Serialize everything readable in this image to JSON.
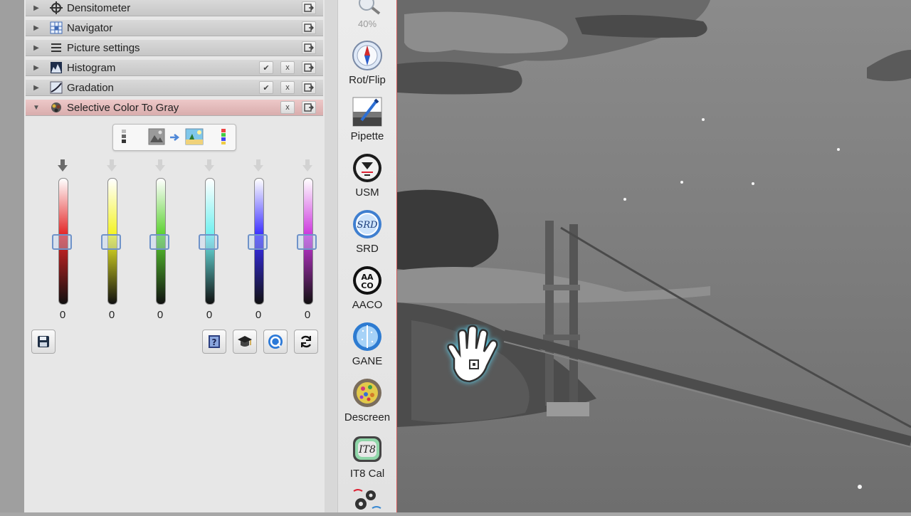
{
  "panel_rows": [
    {
      "label": "Densitometer",
      "icon": "crosshair-icon",
      "expanded": false,
      "active": false,
      "checkable": false,
      "removable": false
    },
    {
      "label": "Navigator",
      "icon": "navigator-icon",
      "expanded": false,
      "active": false,
      "checkable": false,
      "removable": false
    },
    {
      "label": "Picture settings",
      "icon": "list-icon",
      "expanded": false,
      "active": false,
      "checkable": false,
      "removable": false
    },
    {
      "label": "Histogram",
      "icon": "histogram-icon",
      "expanded": false,
      "active": false,
      "checkable": true,
      "removable": true
    },
    {
      "label": "Gradation",
      "icon": "gradation-icon",
      "expanded": false,
      "active": false,
      "checkable": true,
      "removable": true
    },
    {
      "label": "Selective Color To Gray",
      "icon": "color-to-gray-icon",
      "expanded": true,
      "active": true,
      "checkable": false,
      "removable": true
    }
  ],
  "check_glyph": "✔",
  "remove_glyph": "x",
  "selective_color": {
    "channels": [
      {
        "name": "red",
        "color": "#e32626",
        "value": "0",
        "active": true
      },
      {
        "name": "yellow",
        "color": "#f3f324",
        "value": "0",
        "active": false
      },
      {
        "name": "green",
        "color": "#5bd130",
        "value": "0",
        "active": false
      },
      {
        "name": "cyan",
        "color": "#6ff0ef",
        "value": "0",
        "active": false
      },
      {
        "name": "blue",
        "color": "#3b2fff",
        "value": "0",
        "active": false
      },
      {
        "name": "magenta",
        "color": "#cc37dd",
        "value": "0",
        "active": false
      }
    ]
  },
  "toolbar": {
    "zoom_label": "40%",
    "tools": [
      {
        "label": "Rot/Flip",
        "icon": "compass-icon"
      },
      {
        "label": "Pipette",
        "icon": "pipette-icon"
      },
      {
        "label": "USM",
        "icon": "usm-icon"
      },
      {
        "label": "SRD",
        "icon": "srd-icon",
        "badge": "SRD"
      },
      {
        "label": "AACO",
        "icon": "aaco-icon",
        "badge": "AA CO"
      },
      {
        "label": "GANE",
        "icon": "gane-icon"
      },
      {
        "label": "Descreen",
        "icon": "descreen-icon"
      },
      {
        "label": "IT8 Cal",
        "icon": "it8-icon",
        "badge": "IT8"
      }
    ]
  }
}
